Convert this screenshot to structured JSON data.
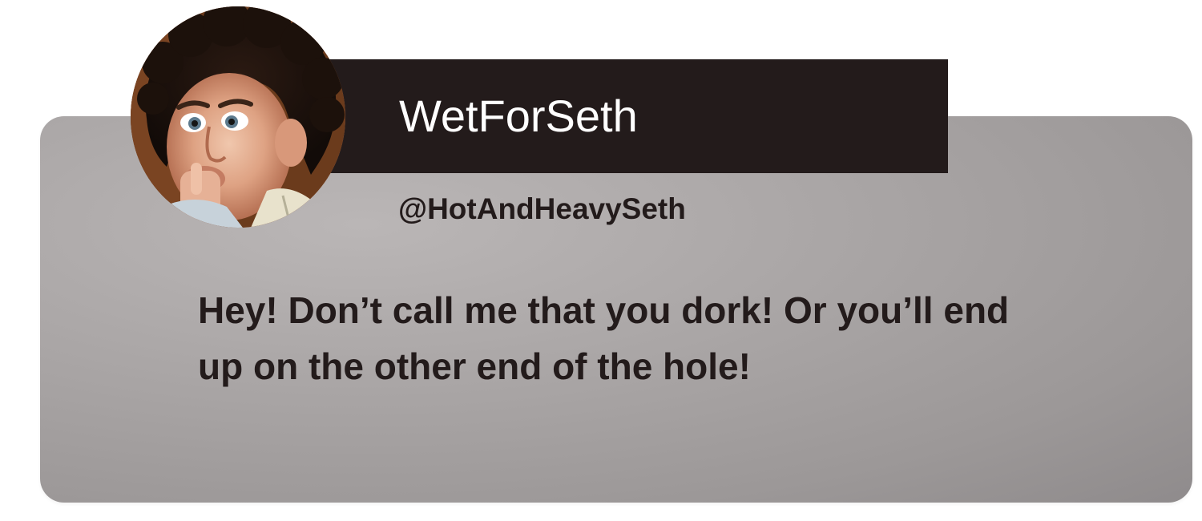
{
  "post": {
    "display_name": "WetForSeth",
    "handle": "@HotAndHeavySeth",
    "message": "Hey! Don’t call me that you dork! Or you’ll end up on the other end of the hole!",
    "avatar": "user-avatar-photo"
  },
  "colors": {
    "name_bar": "#231b1b",
    "card_gradient_light": "#bab6b6",
    "card_gradient_dark": "#8f8b8c",
    "text_dark": "#231b1b",
    "text_light": "#ffffff"
  }
}
